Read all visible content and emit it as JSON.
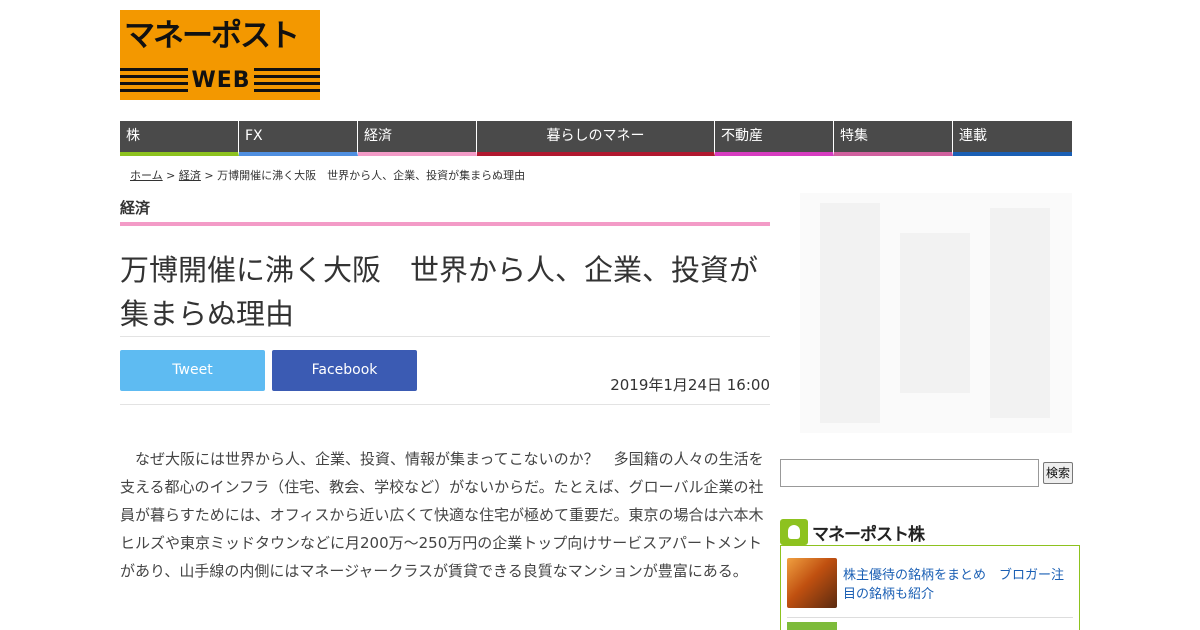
{
  "logo": {
    "main": "マネーポスト",
    "sub": "WEB"
  },
  "nav": [
    {
      "label": "株",
      "color": "#8dc21f"
    },
    {
      "label": "FX",
      "color": "#4f8fe0"
    },
    {
      "label": "経済",
      "color": "#f39bc7"
    },
    {
      "label": "暮らしのマネー",
      "color": "#b0182f"
    },
    {
      "label": "不動産",
      "color": "#d63cc0"
    },
    {
      "label": "特集",
      "color": "#d0609e"
    },
    {
      "label": "連載",
      "color": "#1a5fb4"
    }
  ],
  "breadcrumb": {
    "home": "ホーム",
    "sep1": " > ",
    "category": "経済",
    "sep2": " > ",
    "current": "万博開催に沸く大阪　世界から人、企業、投資が集まらぬ理由"
  },
  "category": "経済",
  "article": {
    "title": "万博開催に沸く大阪　世界から人、企業、投資が集まらぬ理由",
    "tweet": "Tweet",
    "facebook": "Facebook",
    "date": "2019年1月24日 16:00",
    "body": "　なぜ大阪には世界から人、企業、投資、情報が集まってこないのか？　多国籍の人々の生活を支える都心のインフラ（住宅、教会、学校など）がないからだ。たとえば、グローバル企業の社員が暮らすためには、オフィスから近い広くて快適な住宅が極めて重要だ。東京の場合は六本木ヒルズや東京ミッドタウンなどに月200万～250万円の企業トップ向けサービスアパートメントがあり、山手線の内側にはマネージャークラスが賃貸できる良質なマンションが豊富にある。"
  },
  "sidebar": {
    "search_button": "検索",
    "kabu_title": "マネーポスト株",
    "kabu_link": "株主優待の銘柄をまとめ　ブロガー注目の銘柄も紹介"
  }
}
